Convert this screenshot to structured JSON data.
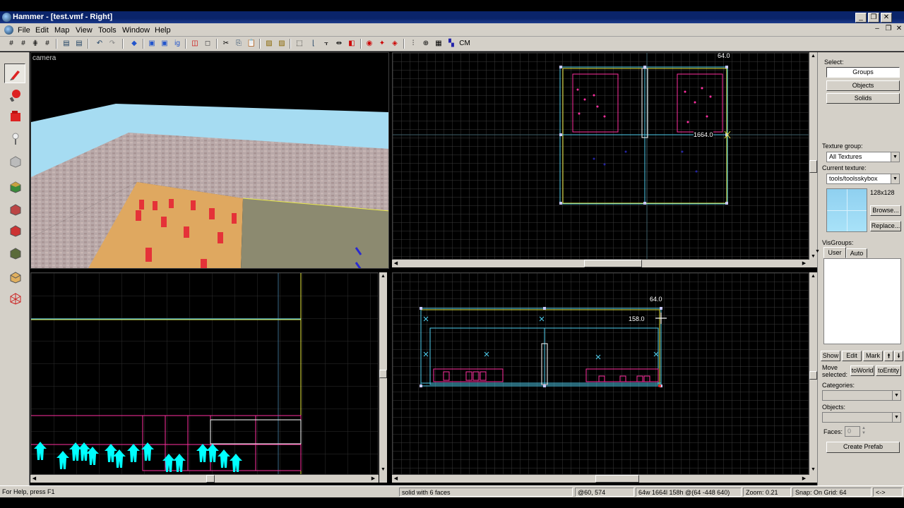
{
  "window": {
    "title": "Hammer - [test.vmf - Right]"
  },
  "menu": {
    "items": [
      "File",
      "Edit",
      "Map",
      "View",
      "Tools",
      "Window",
      "Help"
    ]
  },
  "views": {
    "camera_label": "camera",
    "top": {
      "dim_width": "64.0",
      "dim_length": "1664.0"
    },
    "front": {
      "dim_width": "64.0",
      "dim_height": "158.0"
    }
  },
  "toolbar": {
    "cm_label": "CM"
  },
  "rightpanel": {
    "select_label": "Select:",
    "groups": "Groups",
    "objects": "Objects",
    "solids": "Solids",
    "texture_group_label": "Texture group:",
    "texture_group_value": "All Textures",
    "current_texture_label": "Current texture:",
    "current_texture_value": "tools/toolsskybox",
    "texture_size": "128x128",
    "browse": "Browse...",
    "replace": "Replace...",
    "visgroups_label": "VisGroups:",
    "tab_user": "User",
    "tab_auto": "Auto",
    "show": "Show",
    "edit": "Edit",
    "mark": "Mark",
    "move_selected": "Move selected:",
    "to_world": "toWorld",
    "to_entity": "toEntity",
    "categories_label": "Categories:",
    "objects_label": "Objects:",
    "faces_label": "Faces:",
    "faces_value": "0",
    "create_prefab": "Create Prefab"
  },
  "status": {
    "help": "For Help, press F1",
    "selection": "solid with 6 faces",
    "coords": "@60, 574",
    "size": "64w 1664l 158h @(64 -448 640)",
    "zoom": "Zoom: 0.21",
    "snap": "Snap: On Grid: 64",
    "misc": "<->"
  },
  "colors": {
    "bbox": "#4fd0f0",
    "brush": "#ff2fa0",
    "entity": "#00ffff",
    "selected_handle": "#ffffff"
  }
}
